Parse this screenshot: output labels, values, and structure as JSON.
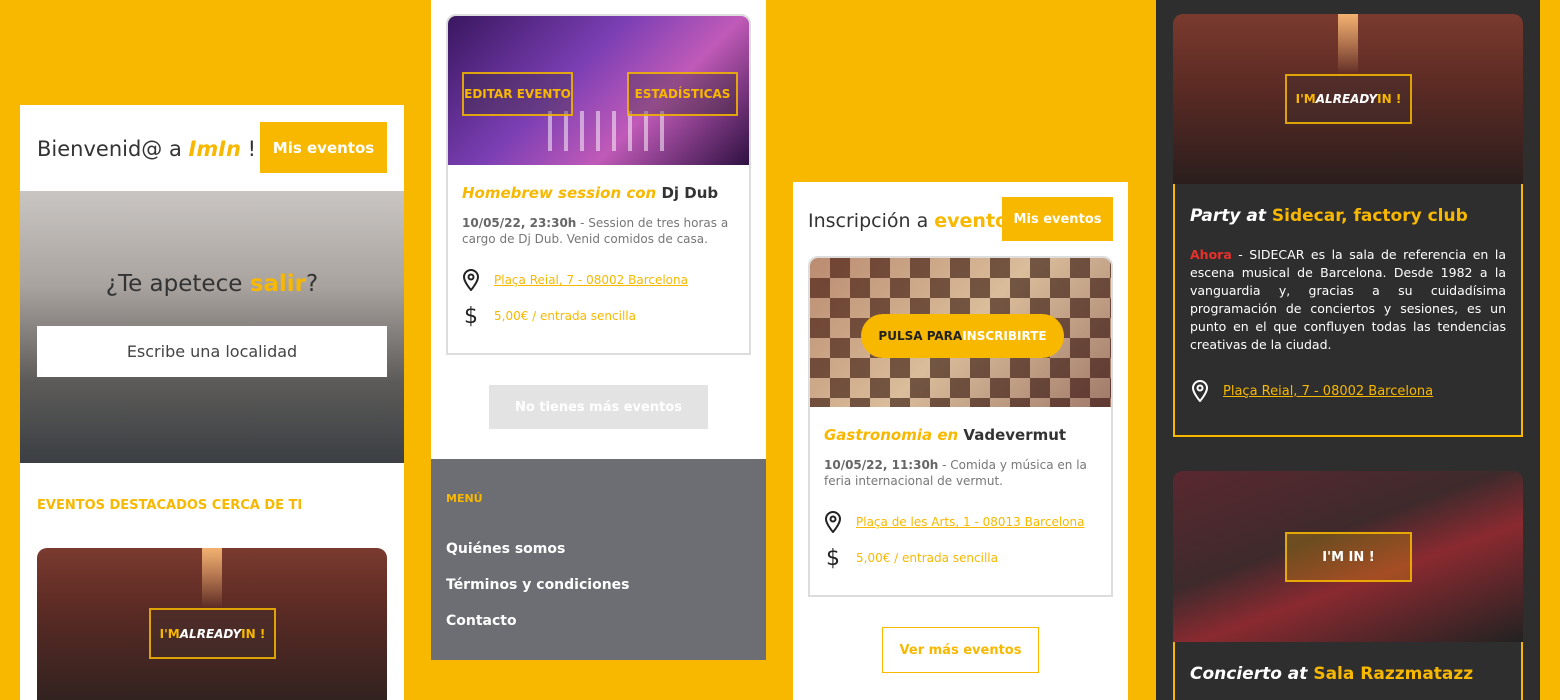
{
  "panel1": {
    "welcome": "Bienvenid@ a ",
    "brand": "ImIn",
    "brand_suffix": " !",
    "my_events": "Mis eventos",
    "hero_q1": "¿Te apetece ",
    "hero_q2": "salir",
    "hero_q3": "?",
    "search_placeholder": "Escribe una localidad",
    "featured": "EVENTOS DESTACADOS CERCA DE TI",
    "already1": "I'M ",
    "already2": "ALREADY",
    "already3": " IN !"
  },
  "panel2": {
    "edit": "EDITAR EVENTO",
    "stats": "ESTADÍSTICAS",
    "title_a": "Homebrew session con ",
    "title_b": "Dj Dub",
    "date": "10/05/22, 23:30h",
    "desc": " - Session de tres horas a cargo de Dj Dub. Venid comidos de casa.",
    "address": "Plaça Reial, 7 - 08002 Barcelona",
    "price": "5,00€ / entrada sencilla",
    "no_more": "No tienes más eventos",
    "menu_title": "MENÚ",
    "menu_items": [
      "Quiénes somos",
      "Términos y condiciones",
      "Contacto"
    ]
  },
  "panel3": {
    "title_a": "Inscripción a ",
    "title_b": "evento",
    "my_events": "Mis eventos",
    "cta_a": "PULSA PARA ",
    "cta_b": "INSCRIBIRTE",
    "ev_a": "Gastronomia en ",
    "ev_b": "Vadevermut",
    "date": "10/05/22, 11:30h",
    "desc": " - Comida y música en la feria internacional de vermut.",
    "address": "Plaça de les Arts, 1 - 08013 Barcelona",
    "price": "5,00€ / entrada sencilla",
    "more": "Ver más eventos"
  },
  "panel4": {
    "already1": "I'M ",
    "already2": "ALREADY",
    "already3": " IN !",
    "ev1_a": "Party at ",
    "ev1_b": "Sidecar, factory club",
    "now": "Ahora",
    "desc": " - SIDECAR es la sala de referencia en la escena musical de Barcelona. Desde 1982 a la vanguardia y, gracias a su cuidadísima programación de conciertos y sesiones, es un punto en el que confluyen todas las tendencias creativas de la ciudad.",
    "address": "Plaça Reial, 7 - 08002 Barcelona",
    "imin": "I'M IN !",
    "ev2_a": "Concierto at ",
    "ev2_b": "Sala Razzmatazz"
  },
  "colors": {
    "accent": "#F8B800",
    "dark": "#2E2E2E",
    "menu": "#6C6E73",
    "alert": "#E8312B"
  },
  "icons": [
    "location-pin-icon",
    "dollar-icon"
  ]
}
